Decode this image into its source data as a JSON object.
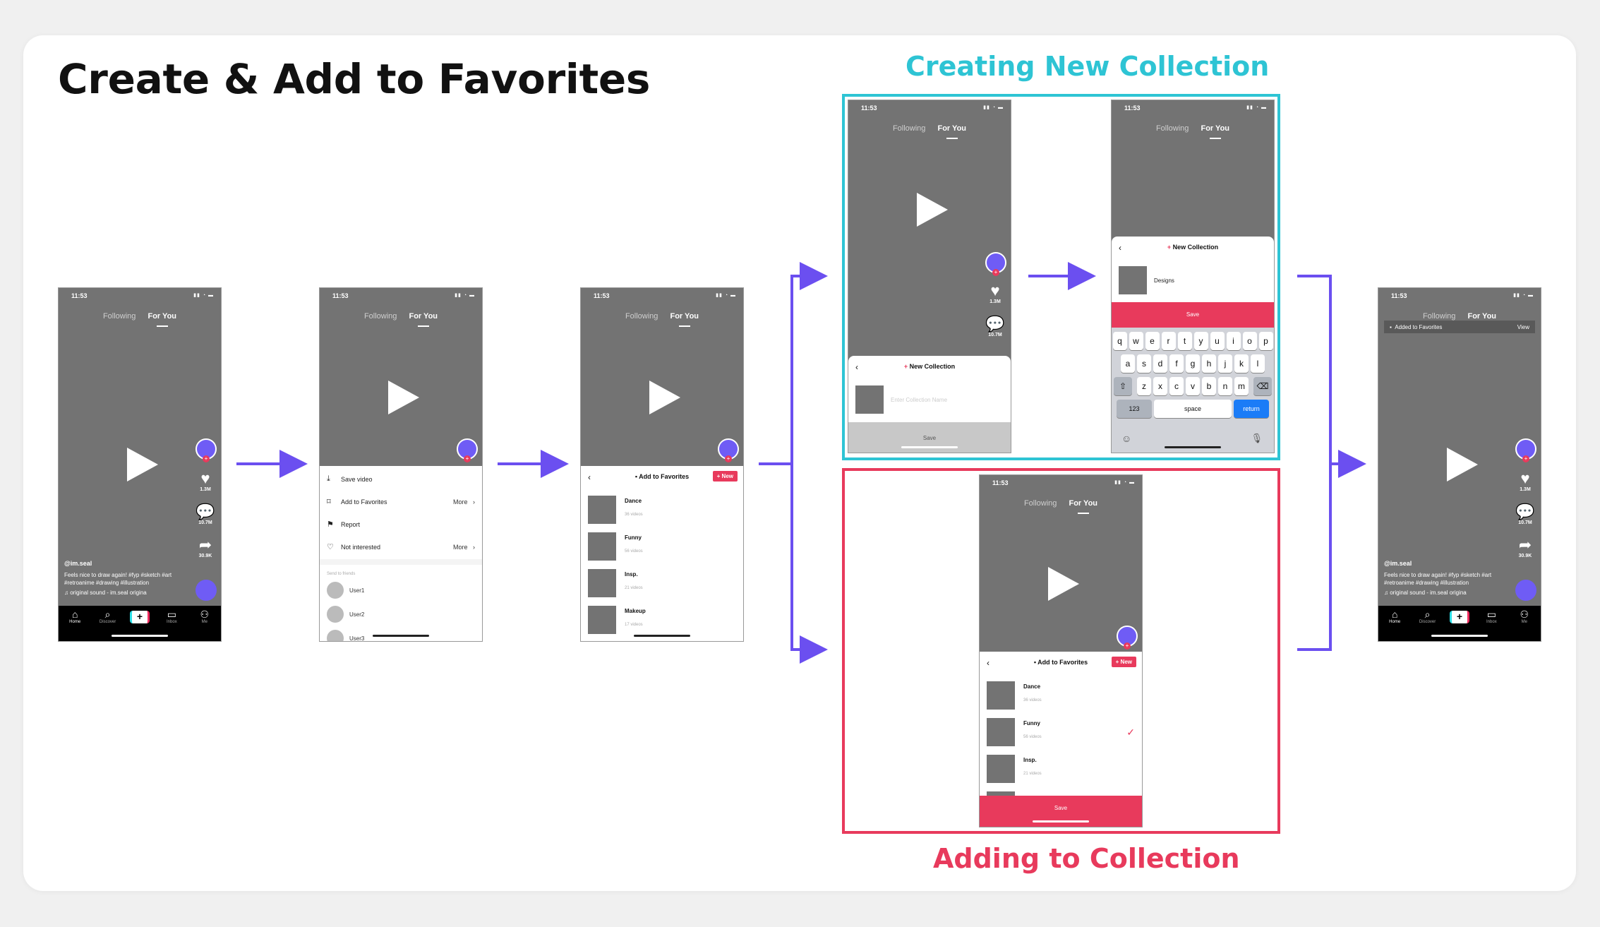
{
  "page_title": "Create & Add to Favorites",
  "sections": {
    "creating": {
      "title": "Creating New Collection",
      "color": "#2ec4d4"
    },
    "adding": {
      "title": "Adding to Collection",
      "color": "#e83a5c"
    }
  },
  "colors": {
    "arrow": "#6b4ff0",
    "accent_red": "#e83a5c",
    "avatar": "#6f5cf5",
    "return_key": "#1b7cf7"
  },
  "status": {
    "time": "11:53",
    "icons": "signal-wifi-battery"
  },
  "tabs": {
    "following": "Following",
    "for_you": "For You"
  },
  "feed": {
    "likes": "1.3M",
    "comments": "10.7M",
    "shares": "30.9K",
    "username": "@im.seal",
    "caption": "Feels nice to draw again! #fyp #sketch #art #retroanime #drawing #illustration",
    "sound": "♫ original sound - im.seal   origina"
  },
  "nav": {
    "home": "Home",
    "discover": "Discover",
    "inbox": "Inbox",
    "me": "Me"
  },
  "share_menu": {
    "save_video": "Save video",
    "add_to_favorites": "Add to Favorites",
    "more": "More",
    "report": "Report",
    "not_interested": "Not interested",
    "send_to_friends": "Send to friends",
    "friends": [
      "User1",
      "User2",
      "User3"
    ]
  },
  "favorites_sheet": {
    "title": "Add to Favorites",
    "new_button": "+ New",
    "collections": [
      {
        "name": "Dance",
        "count": "36 videos"
      },
      {
        "name": "Funny",
        "count": "56 videos"
      },
      {
        "name": "Insp.",
        "count": "21 videos"
      },
      {
        "name": "Makeup",
        "count": "17 videos"
      }
    ],
    "save": "Save"
  },
  "new_collection": {
    "title": "New Collection",
    "placeholder": "Enter Collection Name",
    "typed_name": "Designs",
    "save": "Save"
  },
  "keyboard": {
    "row1": [
      "q",
      "w",
      "e",
      "r",
      "t",
      "y",
      "u",
      "i",
      "o",
      "p"
    ],
    "row2": [
      "a",
      "s",
      "d",
      "f",
      "g",
      "h",
      "j",
      "k",
      "l"
    ],
    "row3": [
      "z",
      "x",
      "c",
      "v",
      "b",
      "n",
      "m"
    ],
    "num_key": "123",
    "space": "space",
    "return": "return"
  },
  "toast": {
    "text": "Added to Favorites",
    "action": "View"
  }
}
